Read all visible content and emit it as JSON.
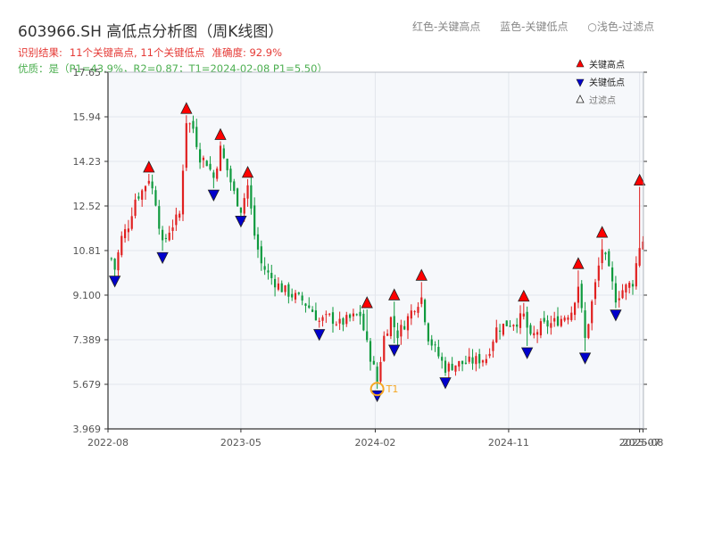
{
  "header": {
    "title": "603966.SH 高低点分析图（周K线图）",
    "legend_text": [
      "红色-关键高点",
      "蓝色-关键低点",
      "○浅色-过滤点"
    ],
    "summary": {
      "prefix": "识别结果:",
      "counts": "11个关键高点, 11个关键低点",
      "accuracy": "准确度: 92.9%"
    },
    "quality": "优质：是（P1=43.9%，R2=0.87；T1=2024-02-08 P1=5.50）"
  },
  "colors": {
    "up": "#e02020",
    "down": "#0f9a3e",
    "key_high": "#ff0000",
    "key_low": "#0000cc",
    "filtered": "#ffffff",
    "t1_marker": "#f5a623",
    "plot_bg": "#f6f8fb",
    "grid": "#e3e6ec",
    "axis": "#333333",
    "tick_text": "#555555"
  },
  "chart_data": {
    "type": "candlestick",
    "title": "603966.SH 高低点分析图（周K线图）",
    "ylim": [
      3.969,
      17.65
    ],
    "yticks": [
      "3.969",
      "5.679",
      "7.389",
      "9.100",
      "10.81",
      "12.52",
      "14.23",
      "15.94",
      "17.65"
    ],
    "xlim": [
      "2022-08-01",
      "2025-08-05"
    ],
    "xticks": [
      {
        "date": "2022-08-01",
        "label": "2022-08"
      },
      {
        "date": "2023-05-01",
        "label": "2023-05"
      },
      {
        "date": "2024-02-01",
        "label": "2024-02"
      },
      {
        "date": "2024-11-01",
        "label": "2024-11"
      },
      {
        "date": "2025-07-28",
        "label": "2025-07"
      },
      {
        "date": "2025-08-04",
        "label": "2025-08"
      }
    ],
    "legend": {
      "position": "top-right",
      "entries": [
        {
          "label": "关键高点",
          "marker": "up-triangle"
        },
        {
          "label": "关键低点",
          "marker": "down-triangle"
        },
        {
          "label": "过滤点",
          "marker": "up-triangle-hollow"
        }
      ]
    },
    "key_highs": [
      {
        "date": "2022-10-24",
        "value": 13.75
      },
      {
        "date": "2023-01-09",
        "value": 16.0
      },
      {
        "date": "2023-03-20",
        "value": 15.0
      },
      {
        "date": "2023-05-15",
        "value": 13.55
      },
      {
        "date": "2024-01-15",
        "value": 8.55
      },
      {
        "date": "2024-03-11",
        "value": 8.85
      },
      {
        "date": "2024-05-06",
        "value": 9.6
      },
      {
        "date": "2024-12-02",
        "value": 8.8
      },
      {
        "date": "2025-03-24",
        "value": 10.05
      },
      {
        "date": "2025-05-12",
        "value": 11.25
      },
      {
        "date": "2025-07-28",
        "value": 13.25
      }
    ],
    "key_lows": [
      {
        "date": "2022-08-15",
        "value": 9.9
      },
      {
        "date": "2022-11-21",
        "value": 10.8
      },
      {
        "date": "2023-03-06",
        "value": 13.2
      },
      {
        "date": "2023-05-01",
        "value": 12.2
      },
      {
        "date": "2023-10-09",
        "value": 7.85
      },
      {
        "date": "2024-02-05",
        "value": 5.5
      },
      {
        "date": "2024-03-11",
        "value": 7.25
      },
      {
        "date": "2024-06-24",
        "value": 6.0
      },
      {
        "date": "2024-12-09",
        "value": 7.15
      },
      {
        "date": "2025-04-07",
        "value": 6.95
      },
      {
        "date": "2025-06-09",
        "value": 8.6
      }
    ],
    "annotation": {
      "label": "T1",
      "date": "2024-02-05",
      "value": 5.5
    },
    "weekly_close_path": [
      [
        "2022-08-08",
        10.5
      ],
      [
        "2022-08-15",
        10.1
      ],
      [
        "2022-08-29",
        11.3
      ],
      [
        "2022-09-12",
        11.8
      ],
      [
        "2022-09-26",
        12.8
      ],
      [
        "2022-10-10",
        13.1
      ],
      [
        "2022-10-24",
        13.6
      ],
      [
        "2022-11-07",
        12.7
      ],
      [
        "2022-11-21",
        11.0
      ],
      [
        "2022-12-05",
        11.6
      ],
      [
        "2022-12-26",
        12.2
      ],
      [
        "2023-01-09",
        15.8
      ],
      [
        "2023-01-23",
        15.5
      ],
      [
        "2023-02-06",
        14.4
      ],
      [
        "2023-02-20",
        14.2
      ],
      [
        "2023-03-06",
        13.6
      ],
      [
        "2023-03-20",
        14.7
      ],
      [
        "2023-04-03",
        13.9
      ],
      [
        "2023-04-17",
        13.0
      ],
      [
        "2023-05-01",
        12.4
      ],
      [
        "2023-05-15",
        13.3
      ],
      [
        "2023-05-29",
        11.4
      ],
      [
        "2023-06-12",
        10.3
      ],
      [
        "2023-06-26",
        9.9
      ],
      [
        "2023-07-10",
        9.6
      ],
      [
        "2023-07-24",
        9.35
      ],
      [
        "2023-08-14",
        9.1
      ],
      [
        "2023-09-04",
        8.9
      ],
      [
        "2023-09-25",
        8.5
      ],
      [
        "2023-10-09",
        8.1
      ],
      [
        "2023-10-30",
        8.25
      ],
      [
        "2023-11-20",
        8.0
      ],
      [
        "2023-12-11",
        8.2
      ],
      [
        "2024-01-01",
        8.35
      ],
      [
        "2024-01-15",
        7.2
      ],
      [
        "2024-01-29",
        6.3
      ],
      [
        "2024-02-05",
        5.8
      ],
      [
        "2024-02-19",
        7.5
      ],
      [
        "2024-03-04",
        8.2
      ],
      [
        "2024-03-18",
        7.6
      ],
      [
        "2024-04-01",
        8.0
      ],
      [
        "2024-04-22",
        8.7
      ],
      [
        "2024-05-06",
        9.0
      ],
      [
        "2024-05-20",
        7.5
      ],
      [
        "2024-06-03",
        7.0
      ],
      [
        "2024-06-24",
        6.3
      ],
      [
        "2024-07-15",
        6.45
      ],
      [
        "2024-08-05",
        6.5
      ],
      [
        "2024-08-26",
        6.6
      ],
      [
        "2024-09-16",
        6.7
      ],
      [
        "2024-10-07",
        7.8
      ],
      [
        "2024-10-28",
        8.0
      ],
      [
        "2024-11-18",
        8.1
      ],
      [
        "2024-12-02",
        8.3
      ],
      [
        "2024-12-16",
        7.4
      ],
      [
        "2025-01-06",
        7.9
      ],
      [
        "2025-01-27",
        8.0
      ],
      [
        "2025-02-17",
        8.2
      ],
      [
        "2025-03-10",
        8.5
      ],
      [
        "2025-03-24",
        9.5
      ],
      [
        "2025-04-07",
        7.4
      ],
      [
        "2025-04-21",
        8.8
      ],
      [
        "2025-05-12",
        10.9
      ],
      [
        "2025-05-26",
        10.0
      ],
      [
        "2025-06-09",
        9.0
      ],
      [
        "2025-06-23",
        9.3
      ],
      [
        "2025-07-14",
        9.6
      ],
      [
        "2025-07-28",
        11.0
      ],
      [
        "2025-08-04",
        11.2
      ]
    ]
  }
}
